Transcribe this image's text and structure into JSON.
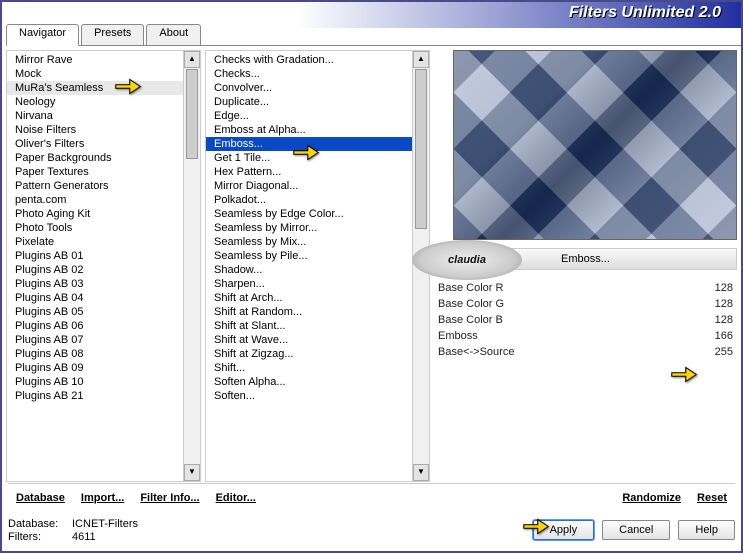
{
  "app": {
    "title": "Filters Unlimited 2.0"
  },
  "tabs": [
    {
      "label": "Navigator",
      "active": true
    },
    {
      "label": "Presets",
      "active": false
    },
    {
      "label": "About",
      "active": false
    }
  ],
  "categories": [
    "Mirror Rave",
    "Mock",
    "MuRa's Seamless",
    "Neology",
    "Nirvana",
    "Noise Filters",
    "Oliver's Filters",
    "Paper Backgrounds",
    "Paper Textures",
    "Pattern Generators",
    "penta.com",
    "Photo Aging Kit",
    "Photo Tools",
    "Pixelate",
    "Plugins AB 01",
    "Plugins AB 02",
    "Plugins AB 03",
    "Plugins AB 04",
    "Plugins AB 05",
    "Plugins AB 06",
    "Plugins AB 07",
    "Plugins AB 08",
    "Plugins AB 09",
    "Plugins AB 10",
    "Plugins AB 21"
  ],
  "categories_hilite_index": 2,
  "filters": [
    "Checks with Gradation...",
    "Checks...",
    "Convolver...",
    "Duplicate...",
    "Edge...",
    "Emboss at Alpha...",
    "Emboss...",
    "Get 1 Tile...",
    "Hex Pattern...",
    "Mirror Diagonal...",
    "Polkadot...",
    "Seamless by Edge Color...",
    "Seamless by Mirror...",
    "Seamless by Mix...",
    "Seamless by Pile...",
    "Shadow...",
    "Sharpen...",
    "Shift at Arch...",
    "Shift at Random...",
    "Shift at Slant...",
    "Shift at Wave...",
    "Shift at Zigzag...",
    "Shift...",
    "Soften Alpha...",
    "Soften..."
  ],
  "filters_selected_index": 6,
  "current_filter": "Emboss...",
  "params": [
    {
      "label": "Base Color R",
      "value": 128
    },
    {
      "label": "Base Color G",
      "value": 128
    },
    {
      "label": "Base Color B",
      "value": 128
    },
    {
      "label": "Emboss",
      "value": 166
    },
    {
      "label": "Base<->Source",
      "value": 255
    }
  ],
  "toolbar": {
    "database": "Database",
    "import": "Import...",
    "filter_info": "Filter Info...",
    "editor": "Editor...",
    "randomize": "Randomize",
    "reset": "Reset"
  },
  "status": {
    "db_label": "Database:",
    "db_value": "ICNET-Filters",
    "filters_label": "Filters:",
    "filters_value": "4611"
  },
  "buttons": {
    "apply": "Apply",
    "cancel": "Cancel",
    "help": "Help"
  },
  "watermark": "claudia"
}
